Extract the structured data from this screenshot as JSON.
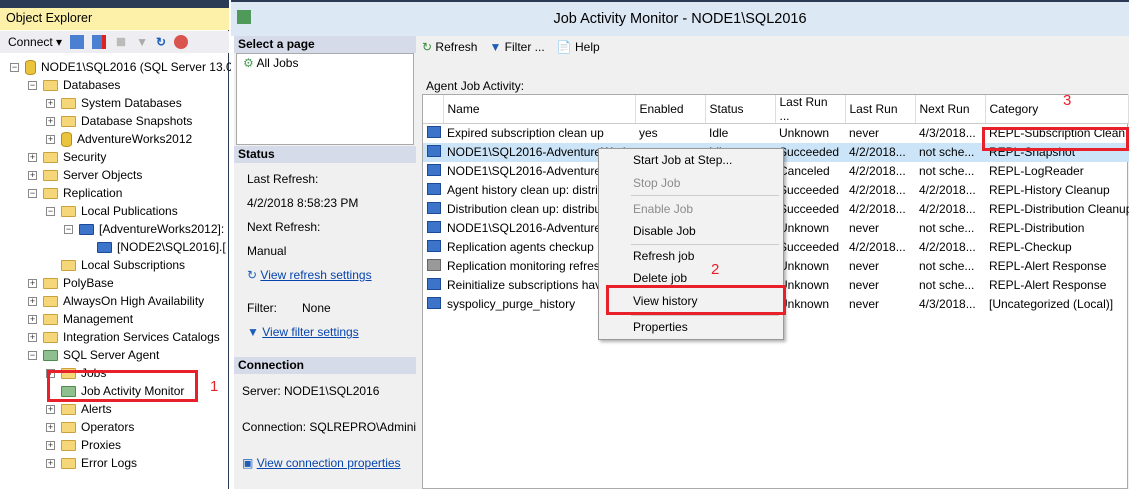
{
  "object_explorer": {
    "title": "Object Explorer",
    "connect_label": "Connect",
    "tree": [
      {
        "label": "NODE1\\SQL2016 (SQL Server 13.0.1",
        "level": 0,
        "expander": "minus",
        "icon": "server-icon"
      },
      {
        "label": "Databases",
        "level": 1,
        "expander": "minus",
        "icon": "folder-icon"
      },
      {
        "label": "System Databases",
        "level": 2,
        "expander": "plus",
        "icon": "folder-icon"
      },
      {
        "label": "Database Snapshots",
        "level": 2,
        "expander": "plus",
        "icon": "folder-icon"
      },
      {
        "label": "AdventureWorks2012",
        "level": 2,
        "expander": "plus",
        "icon": "database-icon"
      },
      {
        "label": "Security",
        "level": 1,
        "expander": "plus",
        "icon": "folder-icon"
      },
      {
        "label": "Server Objects",
        "level": 1,
        "expander": "plus",
        "icon": "folder-icon"
      },
      {
        "label": "Replication",
        "level": 1,
        "expander": "minus",
        "icon": "folder-icon"
      },
      {
        "label": "Local Publications",
        "level": 2,
        "expander": "minus",
        "icon": "folder-icon"
      },
      {
        "label": "[AdventureWorks2012]:",
        "level": 3,
        "expander": "minus",
        "icon": "publication-icon"
      },
      {
        "label": "[NODE2\\SQL2016].[",
        "level": 4,
        "expander": "",
        "icon": "subscription-icon"
      },
      {
        "label": "Local Subscriptions",
        "level": 2,
        "expander": "",
        "icon": "folder-icon"
      },
      {
        "label": "PolyBase",
        "level": 1,
        "expander": "plus",
        "icon": "folder-icon"
      },
      {
        "label": "AlwaysOn High Availability",
        "level": 1,
        "expander": "plus",
        "icon": "folder-icon"
      },
      {
        "label": "Management",
        "level": 1,
        "expander": "plus",
        "icon": "folder-icon"
      },
      {
        "label": "Integration Services Catalogs",
        "level": 1,
        "expander": "plus",
        "icon": "folder-icon"
      },
      {
        "label": "SQL Server Agent",
        "level": 1,
        "expander": "minus",
        "icon": "agent-icon"
      },
      {
        "label": "Jobs",
        "level": 2,
        "expander": "plus",
        "icon": "folder-icon"
      },
      {
        "label": "Job Activity Monitor",
        "level": 2,
        "expander": "",
        "icon": "job-monitor-icon"
      },
      {
        "label": "Alerts",
        "level": 2,
        "expander": "plus",
        "icon": "folder-icon"
      },
      {
        "label": "Operators",
        "level": 2,
        "expander": "plus",
        "icon": "folder-icon"
      },
      {
        "label": "Proxies",
        "level": 2,
        "expander": "plus",
        "icon": "folder-icon"
      },
      {
        "label": "Error Logs",
        "level": 2,
        "expander": "plus",
        "icon": "folder-icon"
      }
    ]
  },
  "window": {
    "title": "Job Activity Monitor - NODE1\\SQL2016"
  },
  "left_pane": {
    "select_page": "Select a page",
    "pages": [
      "All Jobs"
    ],
    "status_header": "Status",
    "last_refresh_label": "Last Refresh:",
    "last_refresh_value": "4/2/2018 8:58:23 PM",
    "next_refresh_label": "Next Refresh:",
    "next_refresh_value": "Manual",
    "view_refresh_settings": "View refresh settings",
    "filter_label": "Filter:",
    "filter_value": "None",
    "view_filter_settings": "View filter settings",
    "connection_header": "Connection",
    "server": "Server: NODE1\\SQL2016",
    "connection": "Connection: SQLREPRO\\Administra",
    "view_connection_properties": "View connection properties"
  },
  "toolbar": {
    "refresh": "Refresh",
    "filter": "Filter ...",
    "help": "Help"
  },
  "grid": {
    "label": "Agent Job Activity:",
    "columns": [
      "Name",
      "Enabled",
      "Status",
      "Last Run ...",
      "Last Run",
      "Next Run",
      "Category"
    ],
    "rows": [
      [
        "Expired subscription clean up",
        "yes",
        "Idle",
        "Unknown",
        "never",
        "4/3/2018...",
        "REPL-Subscription Clean..."
      ],
      [
        "NODE1\\SQL2016-AdventureWork...",
        "yes",
        "Idle",
        "Succeeded",
        "4/2/2018...",
        "not sche...",
        "REPL-Snapshot"
      ],
      [
        "NODE1\\SQL2016-AdventureW",
        "",
        "",
        "Canceled",
        "4/2/2018...",
        "not sche...",
        "REPL-LogReader"
      ],
      [
        "Agent history clean up: distributio",
        "",
        "",
        "Succeeded",
        "4/2/2018...",
        "4/2/2018...",
        "REPL-History Cleanup"
      ],
      [
        "Distribution clean up: distribution",
        "",
        "",
        "Succeeded",
        "4/2/2018...",
        "4/2/2018...",
        "REPL-Distribution Cleanup"
      ],
      [
        "NODE1\\SQL2016-AdventureW",
        "",
        "",
        "Unknown",
        "never",
        "not sche...",
        "REPL-Distribution"
      ],
      [
        "Replication agents checkup",
        "",
        "",
        "Succeeded",
        "4/2/2018...",
        "4/2/2018...",
        "REPL-Checkup"
      ],
      [
        "Replication monitoring refresher",
        "",
        "",
        "Unknown",
        "never",
        "not sche...",
        "REPL-Alert Response"
      ],
      [
        "Reinitialize subscriptions having",
        "",
        "",
        "Unknown",
        "never",
        "not sche...",
        "REPL-Alert Response"
      ],
      [
        "syspolicy_purge_history",
        "",
        "",
        "Unknown",
        "never",
        "4/3/2018...",
        "[Uncategorized (Local)]"
      ]
    ],
    "selected_row": 1
  },
  "context_menu": {
    "items": [
      {
        "label": "Start Job at Step...",
        "enabled": true
      },
      {
        "label": "Stop Job",
        "enabled": false
      },
      {
        "label": "Enable Job",
        "enabled": false
      },
      {
        "label": "Disable Job",
        "enabled": true
      },
      {
        "label": "Refresh job",
        "enabled": true
      },
      {
        "label": "Delete job",
        "enabled": true
      },
      {
        "label": "View history",
        "enabled": true
      },
      {
        "label": "Properties",
        "enabled": true
      }
    ]
  },
  "annotations": [
    "1",
    "2",
    "3"
  ],
  "colors": {
    "highlight": "#e8202a",
    "selection": "#cce4f7",
    "header_yellow": "#fdf1a9"
  }
}
